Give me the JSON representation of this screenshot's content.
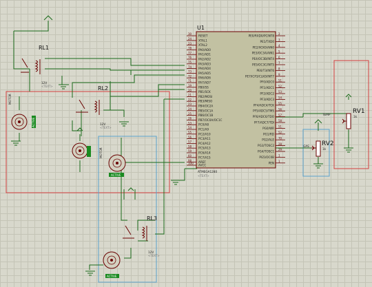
{
  "chip": {
    "ref": "U1",
    "part": "ATMEGA1280",
    "text_placeholder": "<TEXT>",
    "left_pins": [
      "RESET",
      "XTAL1",
      "XTAL2",
      "PA0/AD0",
      "PA1/AD1",
      "PA2/AD2",
      "PA3/AD3",
      "PA4/AD4",
      "PA5/AD5",
      "PA6/AD6",
      "PA7/AD7",
      "PB0/SS",
      "PB1/SCK",
      "PB2/MOSI",
      "PB3/MISO",
      "PB4/OC2A",
      "PB5/OC1A",
      "PB6/OC1B",
      "PB7/OC0A/OC1C",
      "PC0/A8",
      "PC1/A9",
      "PC2/A10",
      "PC3/A11",
      "PC4/A12",
      "PC5/A13",
      "PC6/A14",
      "PC7/A15",
      "AREF",
      "AVCC"
    ],
    "left_nums": [
      "30",
      "24",
      "23",
      "78",
      "77",
      "76",
      "75",
      "74",
      "73",
      "72",
      "71",
      "19",
      "20",
      "21",
      "22",
      "23",
      "24",
      "25",
      "26",
      "53",
      "54",
      "55",
      "56",
      "57",
      "58",
      "59",
      "60",
      "98",
      "100"
    ],
    "right_pins": [
      "PE0/RXD0/PCINT8",
      "PE1/TXD0",
      "PE2/XCK0/AIN0",
      "PE3/OC3A/AIN1",
      "PE4/OC3B/INT4",
      "PE5/OC3C/INT5",
      "PE6/T3/INT6",
      "PE7/ICP3/CLKO/INT7",
      "PF0/ADC0",
      "PF1/ADC1",
      "PF2/ADC2",
      "PF3/ADC3",
      "PF4/ADC4/TCK",
      "PF5/ADC5/TMS",
      "PF6/ADC6/TDO",
      "PF7/ADC7/TDI",
      "PG0/WR",
      "PG1/RD",
      "PG2/ALE",
      "PG3/TOSC2",
      "PG4/TOSC1",
      "PG5/OC0B",
      "PEN"
    ],
    "right_nums": [
      "2",
      "3",
      "4",
      "5",
      "6",
      "7",
      "8",
      "9",
      "51",
      "52",
      "53",
      "54",
      "55",
      "56",
      "57",
      "58",
      "51",
      "52",
      "70",
      "28",
      "29",
      "1",
      "1"
    ]
  },
  "relays": [
    {
      "ref": "RL1",
      "voltage": "12V",
      "text": "<TEXT>"
    },
    {
      "ref": "RL2",
      "voltage": "12V",
      "text": "<TEXT>"
    },
    {
      "ref": "RL3",
      "voltage": "12V",
      "text": "<TEXT>"
    }
  ],
  "motors": [
    {
      "label": "MOTOR",
      "badge": "ACTIVE"
    },
    {
      "label": "MOTOR",
      "badge": ""
    },
    {
      "label": "",
      "badge": "ACTIVE"
    },
    {
      "label": "",
      "badge": "ACTIVE"
    }
  ],
  "pots": [
    {
      "ref": "RV1",
      "value": "1k",
      "net": "TEMP"
    },
    {
      "ref": "RV2",
      "value": "1k",
      "net": "GAS"
    }
  ],
  "colors": {
    "wire": "#1a6a1a",
    "component": "#6a0000",
    "chip_fill": "#c2c1a2",
    "red_frame": "#d34040",
    "blue_frame": "#5aa2cc"
  }
}
